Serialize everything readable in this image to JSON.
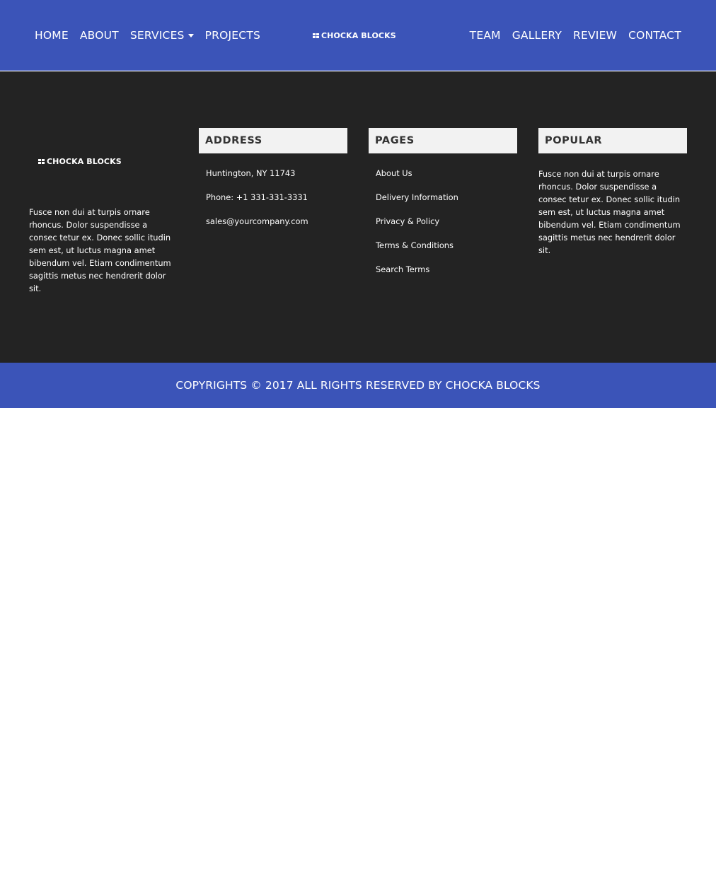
{
  "colors": {
    "primary": "#3b54b8",
    "footer_bg": "#232323",
    "heading_bg": "#f2f2f2"
  },
  "brand": {
    "name": "CHOCKA BLOCKS"
  },
  "nav": {
    "left": [
      {
        "label": "HOME"
      },
      {
        "label": "ABOUT"
      },
      {
        "label": "SERVICES"
      },
      {
        "label": "PROJECTS"
      }
    ],
    "right": [
      {
        "label": "TEAM"
      },
      {
        "label": "GALLERY"
      },
      {
        "label": "REVIEW"
      },
      {
        "label": "CONTACT"
      }
    ]
  },
  "footer": {
    "about_text": "Fusce non dui at turpis ornare rhoncus. Dolor suspendisse a consec tetur ex. Donec sollic itudin sem est, ut luctus magna amet bibendum vel. Etiam condimentum sagittis metus nec hendrerit dolor sit.",
    "address": {
      "title": "ADDRESS",
      "lines": [
        "Huntington, NY 11743",
        "Phone: +1 331-331-3331",
        "sales@yourcompany.com"
      ]
    },
    "pages": {
      "title": "PAGES",
      "links": [
        "About Us",
        "Delivery Information",
        "Privacy & Policy",
        "Terms & Conditions",
        "Search Terms"
      ]
    },
    "popular": {
      "title": "POPULAR",
      "text": "Fusce non dui at turpis ornare rhoncus. Dolor suspendisse a consec tetur ex. Donec sollic itudin sem est, ut luctus magna amet bibendum vel. Etiam condimentum sagittis metus nec hendrerit dolor sit."
    }
  },
  "copyright": "COPYRIGHTS © 2017 ALL RIGHTS RESERVED BY CHOCKA BLOCKS"
}
